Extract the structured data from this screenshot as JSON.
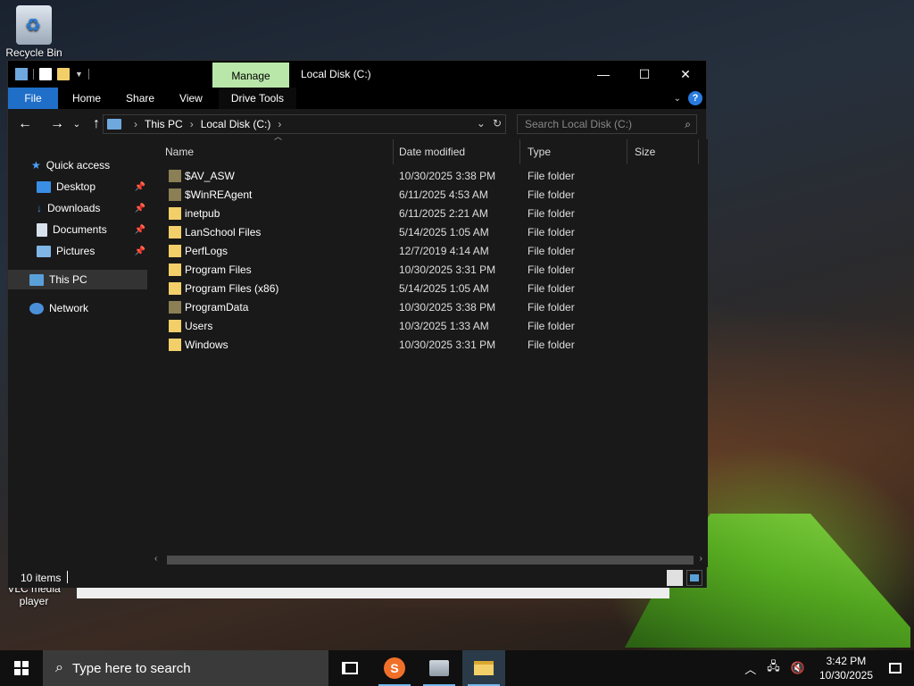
{
  "desktop": {
    "icons": [
      {
        "label": "Recycle Bin"
      },
      {
        "label": "VLC media player"
      }
    ]
  },
  "window": {
    "title": "Local Disk (C:)",
    "manage_tab": "Manage",
    "ribbon_tabs": [
      "File",
      "Home",
      "Share",
      "View",
      "Drive Tools"
    ],
    "accent_color": "#1f6fc8",
    "manage_color": "#b9e7a9"
  },
  "address": {
    "crumbs": [
      "This PC",
      "Local Disk (C:)"
    ],
    "search_placeholder": "Search Local Disk (C:)"
  },
  "navpane": {
    "items": [
      {
        "label": "Quick access",
        "icon": "star-icon"
      },
      {
        "label": "Desktop",
        "icon": "desktop-icon",
        "pinned": true
      },
      {
        "label": "Downloads",
        "icon": "download-icon",
        "pinned": true
      },
      {
        "label": "Documents",
        "icon": "documents-icon",
        "pinned": true
      },
      {
        "label": "Pictures",
        "icon": "pictures-icon",
        "pinned": true
      },
      {
        "label": "This PC",
        "icon": "computer-icon",
        "selected": true
      },
      {
        "label": "Network",
        "icon": "network-icon"
      }
    ]
  },
  "filelist": {
    "columns": [
      "Name",
      "Date modified",
      "Type",
      "Size"
    ],
    "rows": [
      {
        "name": "$AV_ASW",
        "date": "10/30/2025 3:38 PM",
        "type": "File folder",
        "hidden": true
      },
      {
        "name": "$WinREAgent",
        "date": "6/11/2025 4:53 AM",
        "type": "File folder",
        "hidden": true
      },
      {
        "name": "inetpub",
        "date": "6/11/2025 2:21 AM",
        "type": "File folder",
        "hidden": false
      },
      {
        "name": "LanSchool Files",
        "date": "5/14/2025 1:05 AM",
        "type": "File folder",
        "hidden": false
      },
      {
        "name": "PerfLogs",
        "date": "12/7/2019 4:14 AM",
        "type": "File folder",
        "hidden": false
      },
      {
        "name": "Program Files",
        "date": "10/30/2025 3:31 PM",
        "type": "File folder",
        "hidden": false
      },
      {
        "name": "Program Files (x86)",
        "date": "5/14/2025 1:05 AM",
        "type": "File folder",
        "hidden": false
      },
      {
        "name": "ProgramData",
        "date": "10/30/2025 3:38 PM",
        "type": "File folder",
        "hidden": true
      },
      {
        "name": "Users",
        "date": "10/3/2025 1:33 AM",
        "type": "File folder",
        "hidden": false
      },
      {
        "name": "Windows",
        "date": "10/30/2025 3:31 PM",
        "type": "File folder",
        "hidden": false
      }
    ]
  },
  "status": {
    "item_count": "10 items"
  },
  "taskbar": {
    "search_placeholder": "Type here to search",
    "apps": [
      "task-view",
      "sublime-text",
      "remote-desktop",
      "file-explorer"
    ],
    "time": "3:42 PM",
    "date": "10/30/2025"
  }
}
